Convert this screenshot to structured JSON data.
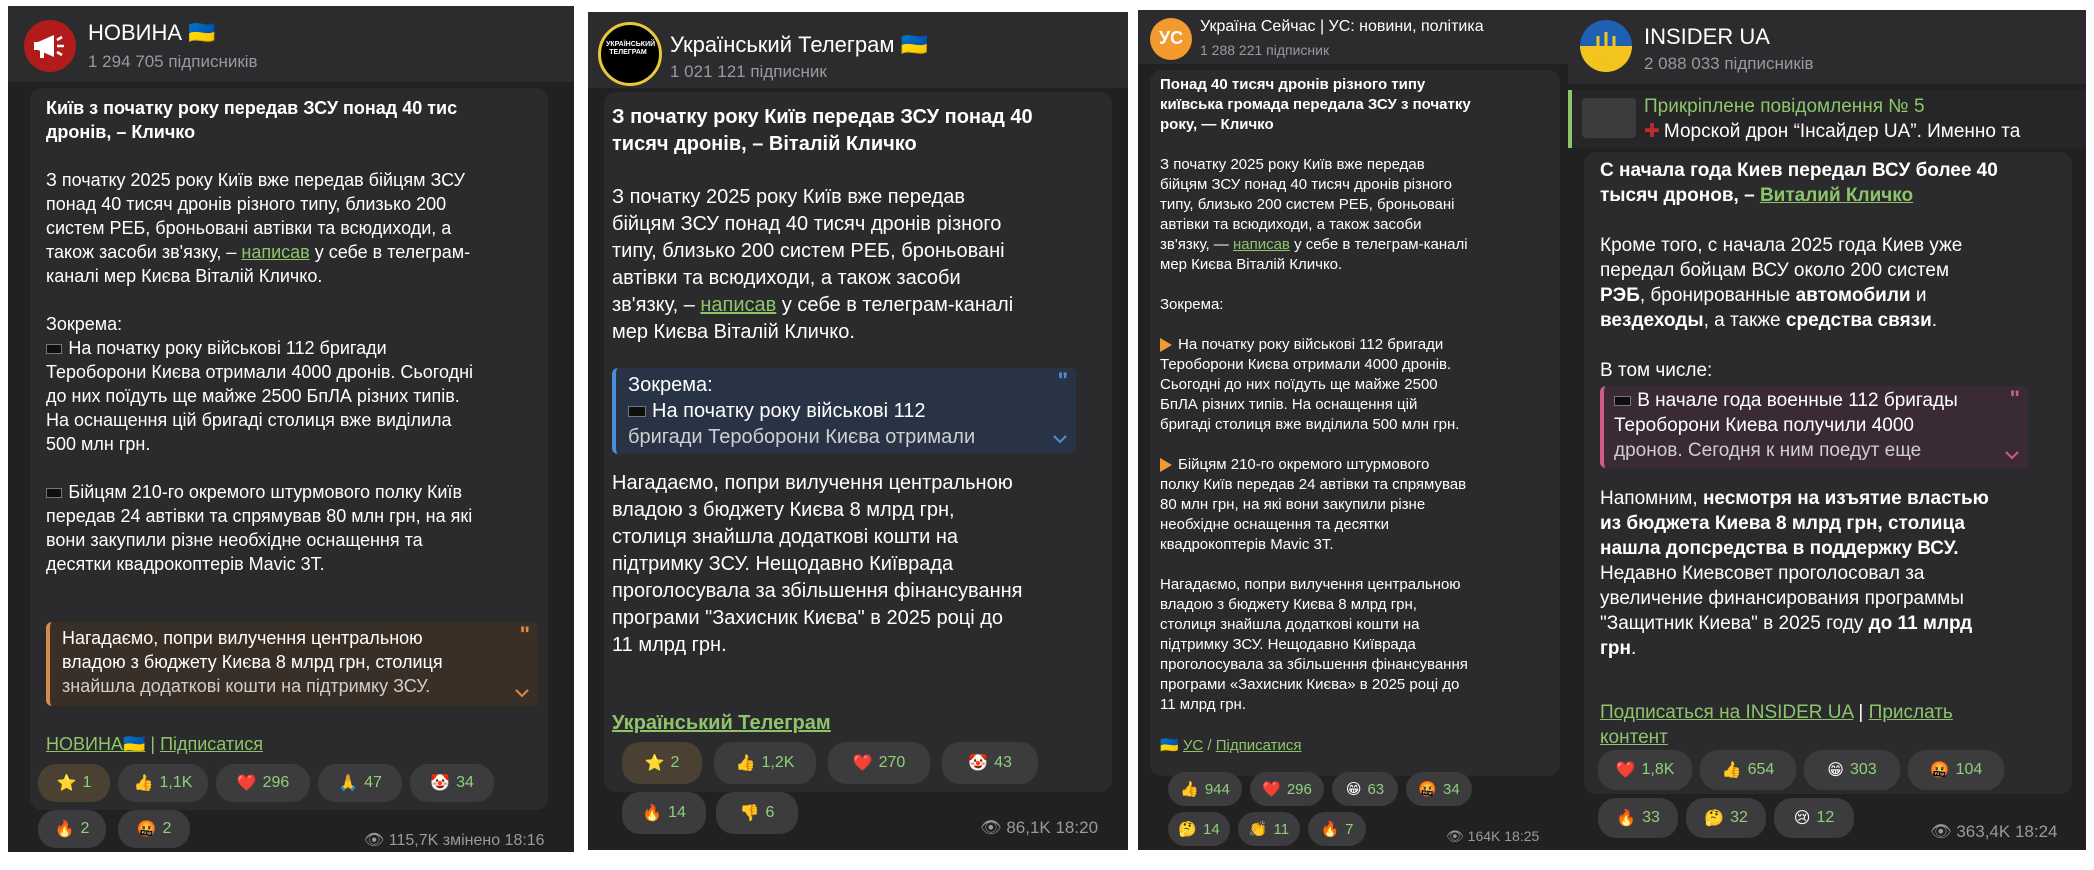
{
  "panels": [
    {
      "channel": "НОВИНА 🇺🇦",
      "subs": "1 294 705 підписників",
      "lines": [
        "Київ з початку року передав ЗСУ понад 40 тис",
        "дронів, – Кличко",
        "З початку 2025 року Київ вже передав бійцям ЗСУ",
        "понад 40 тисяч дронів різного типу, близько 200",
        "систем РЕБ, броньовані автівки та всюдиходи, а",
        "також засоби зв'язку, – ",
        "написав",
        " у себе в телеграм-",
        "каналі мер Києва Віталій Кличко.",
        "Зокрема:",
        "На початку року військові 112 бригади",
        "Тероборони Києва отримали 4000 дронів. Сьогодні",
        "до них поїдуть ще  майже 2500 БпЛА різних типів.",
        "На оснащення цій бригаді столиця вже виділила",
        "500 млн грн.",
        "Бійцям 210-го окремого штурмового полку Київ",
        "передав 24 автівки та спрямував 80 млн грн, на які",
        "вони  закупили різне необхідне оснащення та",
        "десятки квадрокоптерів Mavic 3T."
      ],
      "quote": [
        "Нагадаємо, попри вилучення центральною",
        "владою з бюджету Києва 8 млрд грн, столиця",
        "знайшла додаткові кошти на підтримку ЗСУ."
      ],
      "footer_link": "НОВИНА🇺🇦",
      "footer_sep": " | ",
      "footer_sub": "Підписатися",
      "reactions": [
        {
          "icon": "⭐",
          "count": "1"
        },
        {
          "icon": "👍",
          "count": "1,1K"
        },
        {
          "icon": "❤️",
          "count": "296"
        },
        {
          "icon": "🙏",
          "count": "47"
        },
        {
          "icon": "🤡",
          "count": "34"
        },
        {
          "icon": "🔥",
          "count": "2"
        },
        {
          "icon": "🤬",
          "count": "2"
        }
      ],
      "meta": "115,7K змінено 18:16"
    },
    {
      "channel": "Український Телеграм 🇺🇦",
      "subs": "1 021 121 підписник",
      "avatar_text": "УКРАЇНСЬКИЙ ТЕЛЕГРАМ",
      "lines": [
        "З початку року Київ передав ЗСУ понад 40",
        "тисяч дронів, – Віталій Кличко",
        "З початку 2025 року Київ вже передав",
        "бійцям ЗСУ понад 40 тисяч дронів різного",
        "типу, близько 200 систем РЕБ, броньовані",
        "автівки та всюдиходи, а також засоби",
        "зв'язку, – ",
        "написав",
        " у себе в телеграм-каналі",
        "мер Києва Віталій Кличко.",
        "Нагадаємо, попри вилучення центральною",
        "владою з бюджету Києва 8 млрд грн,",
        "столиця знайшла додаткові кошти на",
        "підтримку ЗСУ. Нещодавно Київрада",
        "проголосувала за збільшення фінансування",
        "програми \"Захисник Києва\" в 2025 році до",
        "11 млрд грн."
      ],
      "quote": [
        "Зокрема:",
        "На початку року військові 112",
        "бригади Тероборони Києва отримали"
      ],
      "footer_link": "Український Телеграм",
      "reactions": [
        {
          "icon": "⭐",
          "count": "2"
        },
        {
          "icon": "👍",
          "count": "1,2K"
        },
        {
          "icon": "❤️",
          "count": "270"
        },
        {
          "icon": "🤡",
          "count": "43"
        },
        {
          "icon": "🔥",
          "count": "14"
        },
        {
          "icon": "👎",
          "count": "6"
        }
      ],
      "meta": "86,1K 18:20"
    },
    {
      "channel": "Україна Сейчас | УС: новини, політика",
      "subs": "1 288 221 підписник",
      "avatar_text": "УС",
      "lines": [
        "Понад 40 тисяч дронів різного типу",
        "київська громада передала ЗСУ з початку",
        "року, — Кличко",
        "З початку 2025 року Київ вже передав",
        "бійцям ЗСУ понад 40 тисяч дронів різного",
        "типу, близько 200 систем РЕБ, броньовані",
        "автівки та всюдиходи, а також засоби",
        "зв'язку, — ",
        "написав",
        " у себе в телеграм-каналі",
        "мер Києва Віталій Кличко.",
        "Зокрема:",
        "На початку року військові 112 бригади",
        "Тероборони Києва отримали 4000 дронів.",
        "Сьогодні до них поїдуть ще  майже 2500",
        "БпЛА різних типів. На оснащення цій",
        "бригаді столиця вже виділила 500 млн грн.",
        "Бійцям 210-го окремого штурмового",
        "полку Київ передав 24 автівки та спрямував",
        "80 млн грн, на які вони закупили різне",
        "необхідне оснащення та десятки",
        "квадрокоптерів Mavic 3T.",
        "Нагадаємо, попри вилучення центральною",
        "владою з бюджету Києва 8 млрд грн,",
        "столиця знайшла додаткові кошти на",
        "підтримку ЗСУ. Нещодавно Київрада",
        "проголосувала за збільшення фінансування",
        "програми «Захисник Києва» в 2025 році до",
        "11 млрд грн."
      ],
      "footer_flag": "🇺🇦",
      "footer_link": "УС",
      "footer_sep": " / ",
      "footer_sub": "Підписатися",
      "reactions": [
        {
          "icon": "👍",
          "count": "944"
        },
        {
          "icon": "❤️",
          "count": "296"
        },
        {
          "icon": "😁",
          "count": "63"
        },
        {
          "icon": "🤬",
          "count": "34"
        },
        {
          "icon": "🤔",
          "count": "14"
        },
        {
          "icon": "👏",
          "count": "11"
        },
        {
          "icon": "🔥",
          "count": "7"
        }
      ],
      "meta": "164K 18:25"
    },
    {
      "channel": "INSIDER UA",
      "subs": "2 088 033 підписників",
      "pinned_title": "Прикріплене повідомлення № 5",
      "pinned_text": "Морской дрон “Інсайдер UA”.   Именно та",
      "lines": [
        "С начала года Киев передал ВСУ более 40",
        "тысяч дронов, – ",
        "Виталий Кличко",
        "Кроме того, с начала 2025 года Киев уже",
        "передал бойцам ВСУ около 200 систем",
        "РЭБ",
        ", бронированные ",
        "автомобили",
        " и",
        "вездеходы",
        ", а также ",
        "средства связи",
        ".",
        "В том числе:",
        "Напомним, ",
        "несмотря на изъятие властью",
        "из бюджета Киева 8 млрд грн, столица",
        "нашла допсредства в поддержку ВСУ.",
        "Недавно Киевсовет проголосовал за",
        "увеличение финансирования программы",
        "\"Защитник Киева\" в 2025 году ",
        "до 11 млрд",
        "грн",
        "."
      ],
      "quote": [
        "В начале года военные 112 бригады",
        "Тероборони Киева получили 4000",
        "дронов. Сегодня к ним поедут еще"
      ],
      "footer_link": "Подписаться на INSIDER UA",
      "footer_sep": " | ",
      "footer_link2": "Прислать",
      "footer_link2b": "контент",
      "reactions": [
        {
          "icon": "❤️",
          "count": "1,8K"
        },
        {
          "icon": "👍",
          "count": "654"
        },
        {
          "icon": "😁",
          "count": "303"
        },
        {
          "icon": "🤬",
          "count": "104"
        },
        {
          "icon": "🔥",
          "count": "33"
        },
        {
          "icon": "🤔",
          "count": "32"
        },
        {
          "icon": "😢",
          "count": "12"
        }
      ],
      "meta": "363,4K 18:24"
    }
  ],
  "colors": {
    "panel_bg": "#212121",
    "header_bg": "#2c2c2e",
    "bubble_bg": "#2b2b2d",
    "link": "#8ec56b",
    "reaction_count": "#8fd07a",
    "meta": "#9a9a9e"
  },
  "icons": [
    "megaphone-icon",
    "eye-icon",
    "quote-icon",
    "chevron-down-icon",
    "pin-icon"
  ]
}
